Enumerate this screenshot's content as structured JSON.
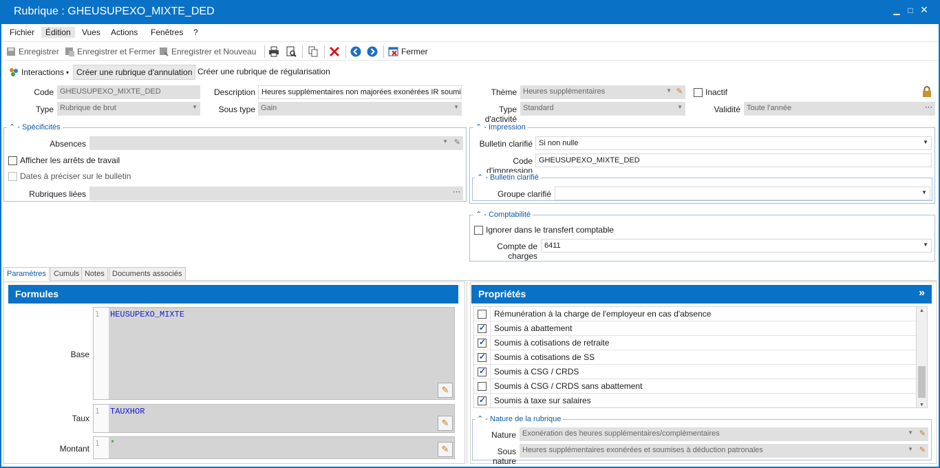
{
  "window": {
    "title": "Rubrique : GHEUSUPEXO_MIXTE_DED"
  },
  "menu": [
    "Fichier",
    "Édition",
    "Vues",
    "Actions",
    "Fenêtres",
    "?"
  ],
  "toolbar": {
    "save": "Enregistrer",
    "save_close": "Enregistrer et Fermer",
    "save_new": "Enregistrer et Nouveau",
    "close": "Fermer"
  },
  "actions": {
    "interactions": "Interactions",
    "cancel_rubric": "Créer une rubrique d'annulation",
    "regul_rubric": "Créer une rubrique de régularisation"
  },
  "header": {
    "code_label": "Code",
    "code_value": "GHEUSUPEXO_MIXTE_DED",
    "type_label": "Type",
    "type_value": "Rubrique de brut",
    "desc_label": "Description",
    "desc_value": "Heures supplémentaires non majorées exonérées IR soumise",
    "subtype_label": "Sous type",
    "subtype_value": "Gain",
    "theme_label": "Thème",
    "theme_value": "Heures supplémentaires",
    "activity_label": "Type d'activité",
    "activity_value": "Standard",
    "inactive_label": "Inactif",
    "validity_label": "Validité",
    "validity_value": "Toute l'année"
  },
  "specificites": {
    "title": "Spécificités",
    "absences_label": "Absences",
    "show_stops": "Afficher les arrêts de travail",
    "dates_label": "Dates à préciser sur le bulletin",
    "linked_label": "Rubriques liées"
  },
  "impression": {
    "title": "Impression",
    "clarified_label": "Bulletin clarifié",
    "clarified_value": "Si non nulle",
    "code_label": "Code d'impression",
    "code_value": "GHEUSUPEXO_MIXTE_DED",
    "sub_title": "Bulletin clarifié",
    "group_label": "Groupe clarifié",
    "group_value": ""
  },
  "comptabilite": {
    "title": "Comptabilité",
    "ignore_label": "Ignorer dans le transfert comptable",
    "account_label": "Compte de charges",
    "account_value": "6411"
  },
  "tabs": [
    "Paramètres",
    "Cumuls",
    "Notes",
    "Documents associés"
  ],
  "formules": {
    "title": "Formules",
    "base_label": "Base",
    "base_value": "HEUSUPEXO_MIXTE",
    "taux_label": "Taux",
    "taux_value": "TAUXHOR",
    "montant_label": "Montant",
    "montant_value": "*",
    "line_number": "1"
  },
  "proprietes": {
    "title": "Propriétés",
    "expand": "»",
    "items": [
      {
        "label": "Rémunération à la charge de l'employeur en cas d'absence",
        "checked": false
      },
      {
        "label": "Soumis à abattement",
        "checked": true
      },
      {
        "label": "Soumis à cotisations de retraite",
        "checked": true
      },
      {
        "label": "Soumis à cotisations de SS",
        "checked": true
      },
      {
        "label": "Soumis à CSG / CRDS",
        "checked": true
      },
      {
        "label": "Soumis à CSG / CRDS sans abattement",
        "checked": false
      },
      {
        "label": "Soumis à taxe sur salaires",
        "checked": true
      }
    ]
  },
  "nature": {
    "title": "Nature de la rubrique",
    "nature_label": "Nature",
    "nature_value": "Exonération des heures supplémentaires/complémentaires",
    "subnature_label": "Sous nature",
    "subnature_value": "Heures supplémentaires exonérées et soumises à déduction patronales"
  },
  "colors": {
    "accent": "#0a72c6",
    "group_border": "#a6bfe0",
    "field_bg": "#e0e0e0"
  }
}
